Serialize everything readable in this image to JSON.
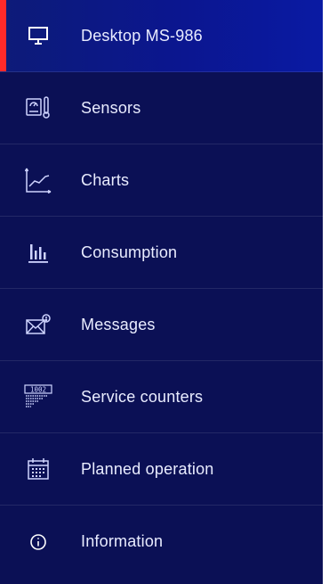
{
  "nav": {
    "items": [
      {
        "label": "Desktop MS-986",
        "icon": "monitor-icon",
        "active": true
      },
      {
        "label": "Sensors",
        "icon": "sensor-thermometer-icon",
        "active": false
      },
      {
        "label": "Charts",
        "icon": "line-chart-icon",
        "active": false
      },
      {
        "label": "Consumption",
        "icon": "bar-chart-icon",
        "active": false
      },
      {
        "label": "Messages",
        "icon": "envelope-icon",
        "active": false
      },
      {
        "label": "Service counters",
        "icon": "counter-icon",
        "active": false,
        "counter_digits": "1002"
      },
      {
        "label": "Planned operation",
        "icon": "calendar-icon",
        "active": false
      },
      {
        "label": "Information",
        "icon": "info-icon",
        "active": false
      }
    ]
  },
  "colors": {
    "background": "#0b1055",
    "active_background": "#0b168f",
    "active_indicator": "#ff2a2a",
    "text": "#e9ecff"
  }
}
